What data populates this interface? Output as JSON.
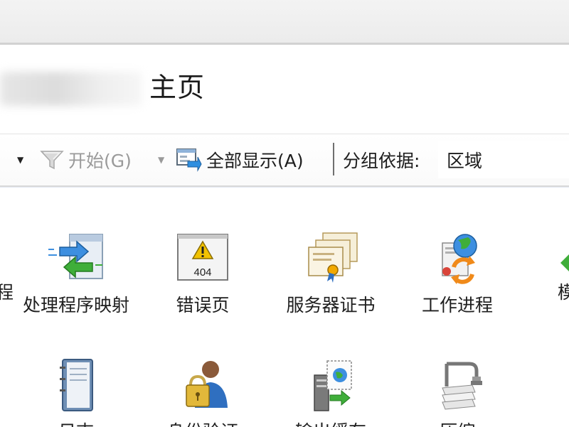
{
  "header": {
    "title": "主页"
  },
  "toolbar": {
    "start_label": "开始(G)",
    "show_all_label": "全部显示(A)",
    "group_by_label": "分组依据:",
    "group_by_value": "区域"
  },
  "features": {
    "row1": [
      {
        "label": "处理程序映射",
        "icon": "handler-mappings-icon"
      },
      {
        "label": "错误页",
        "icon": "error-pages-icon"
      },
      {
        "label": "服务器证书",
        "icon": "server-certificates-icon"
      },
      {
        "label": "工作进程",
        "icon": "worker-processes-icon"
      }
    ],
    "row2": [
      {
        "label": "日志",
        "icon": "logging-icon"
      },
      {
        "label": "身份验证",
        "icon": "authentication-icon"
      },
      {
        "label": "输出缓存",
        "icon": "output-caching-icon"
      },
      {
        "label": "压缩",
        "icon": "compression-icon"
      }
    ],
    "error_icon_text": "404",
    "clipped_left_text": "程",
    "clipped_right_text": "模"
  },
  "colors": {
    "accent_blue": "#2f8fe0",
    "arrow_green": "#3fae3a",
    "warning_yellow": "#f2c200"
  }
}
